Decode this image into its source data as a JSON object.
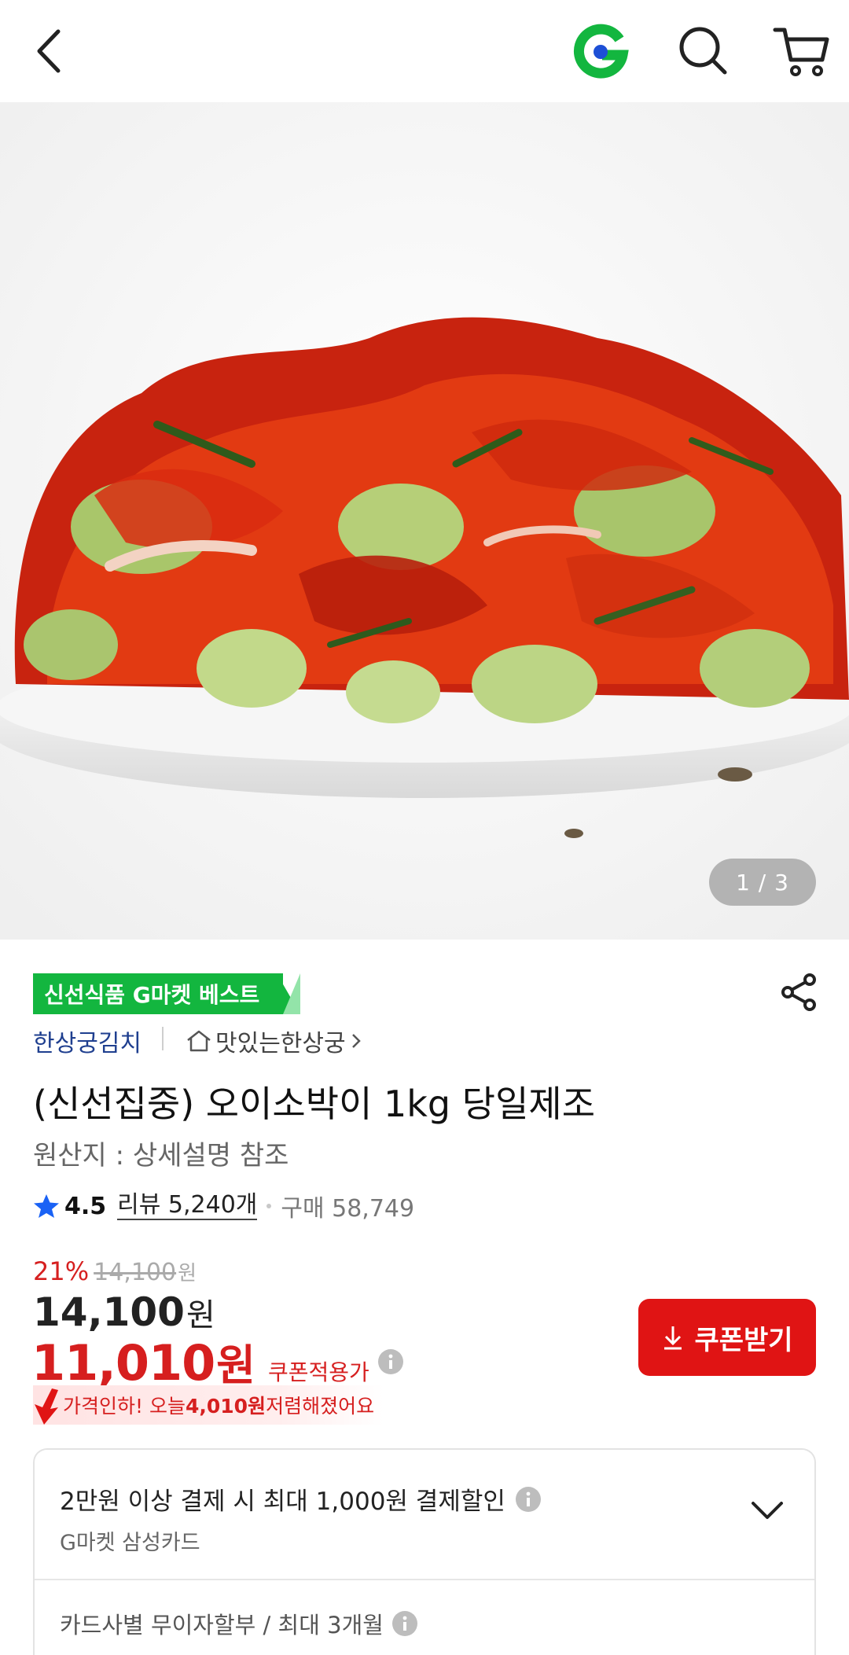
{
  "header": {
    "back_icon": "chevron-left-icon",
    "logo_icon": "gmarket-g-logo",
    "search_icon": "search-icon",
    "cart_icon": "cart-icon",
    "brand_color": "#13b63f"
  },
  "gallery": {
    "current": "1",
    "total": "3",
    "pager_text": "1 / 3"
  },
  "product": {
    "badge": "신선식품 G마켓 베스트",
    "seller": "한상궁김치",
    "shop": "맛있는한상궁",
    "title": "(신선집중) 오이소박이 1kg 당일제조",
    "origin": "원산지 : 상세설명 참조",
    "rating": "4.5",
    "review": "리뷰 5,240개",
    "purchase": "구매 58,749"
  },
  "price": {
    "discount_pct": "21%",
    "original": "14,100",
    "original_unit": "원",
    "sale": "14,100",
    "sale_unit": "원",
    "coupon_price": "11,010",
    "coupon_unit": "원",
    "coupon_label": "쿠폰적용가",
    "drop_prefix": "가격인하! 오늘 ",
    "drop_amount": "4,010원",
    "drop_suffix": " 저렴해졌어요",
    "coupon_button": "쿠폰받기",
    "accent_color": "#e01414"
  },
  "card_benefit": {
    "promo": "2만원 이상 결제 시 최대 1,000원 결제할인",
    "card_name": "G마켓 삼성카드",
    "installment": "카드사별 무이자할부 / 최대 3개월"
  }
}
